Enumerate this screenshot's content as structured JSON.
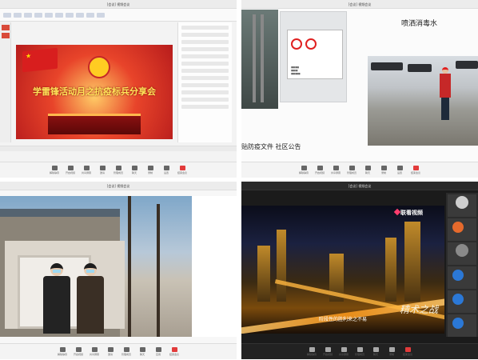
{
  "meeting": {
    "window_title": "[会议] 视频会议",
    "toolbar": [
      {
        "label": "解除静音",
        "icon": "microphone-icon"
      },
      {
        "label": "开启视频",
        "icon": "camera-icon"
      },
      {
        "label": "共享屏幕",
        "icon": "screen-share-icon"
      },
      {
        "label": "邀请",
        "icon": "invite-icon"
      },
      {
        "label": "管理成员",
        "icon": "members-icon"
      },
      {
        "label": "聊天",
        "icon": "chat-icon"
      },
      {
        "label": "录制",
        "icon": "record-icon"
      },
      {
        "label": "应用",
        "icon": "apps-icon"
      },
      {
        "label": "设置",
        "icon": "gear-icon"
      },
      {
        "label": "结束会议",
        "icon": "end-call-icon"
      }
    ]
  },
  "q1": {
    "slide_title": "学雷锋活动月之抗疫标兵分享会"
  },
  "q2": {
    "title": "喷洒消毒水",
    "caption": "贴防疫文件 社区公告"
  },
  "q4": {
    "brand": "联看视频",
    "subtitle": "阶段性的胜利来之不易",
    "calligraphy": "精术之战"
  },
  "colors": {
    "slide_red": "#d81e1e",
    "end_call": "#e23b3b",
    "accent": "#ffd800"
  }
}
